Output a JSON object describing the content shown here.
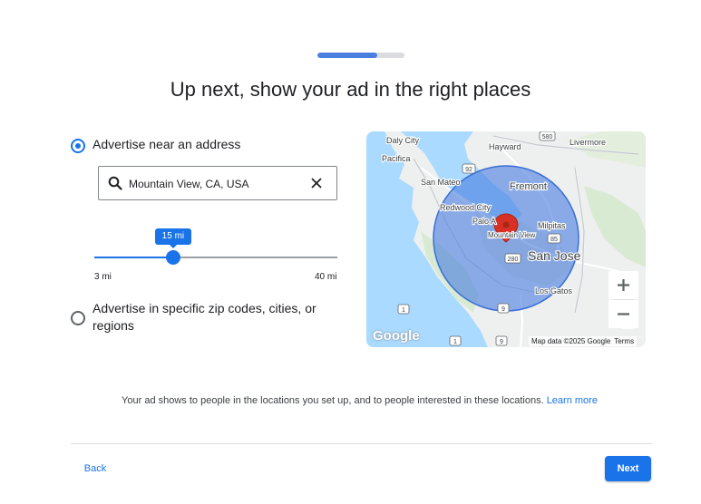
{
  "progress": {
    "value": 0.69
  },
  "title": "Up next, show your ad in the right places",
  "options": {
    "address": {
      "label": "Advertise near an address",
      "selected": true
    },
    "regions": {
      "label": "Advertise in specific zip codes, cities, or regions",
      "selected": false
    }
  },
  "search": {
    "value": "Mountain View, CA, USA",
    "icon": "search-icon",
    "clear_icon": "close-icon"
  },
  "radius": {
    "value_label": "15 mi",
    "value": 15,
    "min": 3,
    "max": 40,
    "min_label": "3 mi",
    "max_label": "40 mi"
  },
  "map": {
    "labels": {
      "daly_city": "Daly City",
      "hayward": "Hayward",
      "livermore": "Livermore",
      "pacifica": "Pacifica",
      "san_mateo": "San Mateo",
      "fremont": "Fremont",
      "redwood_city": "Redwood City",
      "palo_alto": "Palo A",
      "milpitas": "Milpitas",
      "mountain_view": "Mountain View",
      "san_jose": "San Jose",
      "los_gatos": "Los Gatos",
      "morgan_hill": "Mo",
      "route_580": "580",
      "route_92": "92",
      "route_85": "85",
      "route_280": "280",
      "route_1": "1",
      "route_9": "9"
    },
    "logo": "Google",
    "attribution": "Map data ©2025 Google",
    "terms": "Terms",
    "water_color": "#aadaff",
    "radius_color": "#4a7fe0",
    "pin_color": "#d93025"
  },
  "info": {
    "text": "Your ad shows to people in the locations you set up, and to people interested in these locations.",
    "link": "Learn more"
  },
  "footer": {
    "back": "Back",
    "next": "Next"
  },
  "colors": {
    "accent": "#1a73e8",
    "text": "#202124"
  }
}
